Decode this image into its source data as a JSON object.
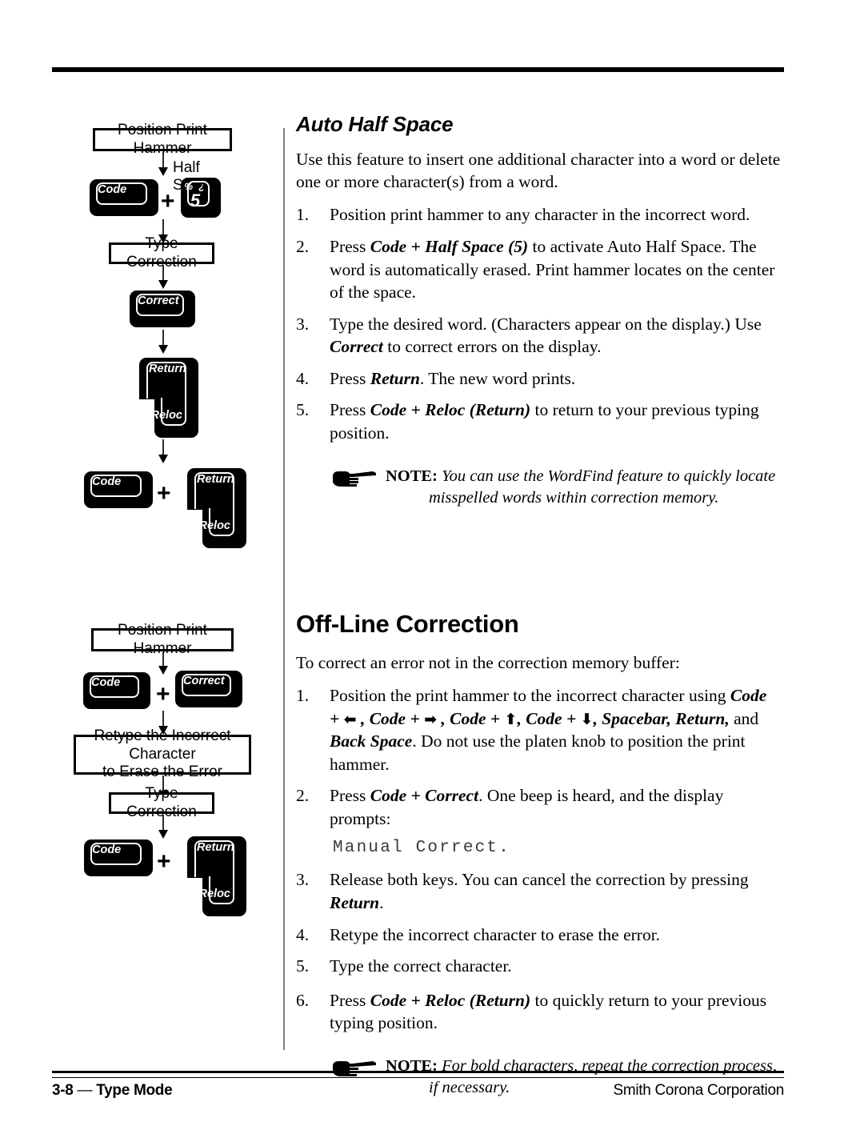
{
  "footer": {
    "left_page": "3-8",
    "left_dash": " — ",
    "left_section": "Type Mode",
    "right": "Smith Corona Corporation"
  },
  "sections": [
    {
      "id": "auto-half-space",
      "title": "Auto Half Space",
      "lead": "Use this feature to insert one additional character into a word or delete one or more character(s) from a word.",
      "steps": [
        {
          "num": "1.",
          "text": "Position print hammer to any character in the incorrect word."
        },
        {
          "num": "2.",
          "text": "Press Code + Half Space (5) to activate Auto Half Space. The word is automatically erased. Print hammer locates on the center of the space."
        },
        {
          "num": "3.",
          "text": "Type the desired word. (Characters appear on the display.) Use Correct to correct errors on the display."
        },
        {
          "num": "4.",
          "text": "Press Return. The new word prints."
        },
        {
          "num": "5.",
          "text": "Press Code + Reloc (Return) to return to your previous typing position."
        }
      ],
      "note": {
        "icon": "pointing-hand-icon",
        "label": "NOTE:",
        "line1": "You can use the WordFind feature to quickly locate",
        "line2": "misspelled words within correction memory."
      }
    },
    {
      "id": "off-line-correction",
      "title": "Off-Line Correction",
      "lead": "To correct an error not in the correction memory buffer:",
      "steps": [
        {
          "num": "1.",
          "text": "Position the print hammer to the incorrect character using Code + ←, Code + →, Code + ↑, Code + ↓, Spacebar, Return, and Back Space. Do not use the platen knob to position the print hammer."
        },
        {
          "num": "2.",
          "text": "Press Code + Correct. One beep is heard, and the display prompts:",
          "display_prompt": "Manual Correct."
        },
        {
          "num": "3.",
          "text": "Release both keys. You can cancel the correction by pressing Return."
        },
        {
          "num": "4.",
          "text": "Retype the incorrect character to erase the error."
        },
        {
          "num": "5.",
          "text": "Type the correct character."
        },
        {
          "num": "6.",
          "text": "Press Code + Reloc (Return) to quickly return to your previous typing position."
        }
      ],
      "note": {
        "icon": "pointing-hand-icon",
        "label": "NOTE:",
        "line1": "For bold characters, repeat the correction process,",
        "line2": "if necessary."
      }
    }
  ],
  "diagrams": {
    "flow1": {
      "box_position_print_hammer": "Position Print Hammer",
      "label_half_space": "Half Space",
      "key_code": "Code",
      "key_5_top": "% ¿",
      "key_5_main": "5",
      "plus": "+",
      "box_type_correction": "Type Correction",
      "key_correct": "Correct",
      "key_return_top": "Return",
      "key_return_bottom": "Reloc",
      "key_code2": "Code",
      "key_return2_top": "Return",
      "key_return2_bottom": "Reloc",
      "plus2": "+"
    },
    "flow2": {
      "box_position_print_hammer": "Position Print Hammer",
      "key_code": "Code",
      "key_correct": "Correct",
      "plus": "+",
      "box_retype": "Retype the Incorrect Character to Erase the Error",
      "box_retype_l1": "Retype the Incorrect Character",
      "box_retype_l2": "to Erase the Error",
      "box_type_correction": "Type Correction",
      "key_code2": "Code",
      "key_return_top": "Return",
      "key_return_bottom": "Reloc",
      "plus2": "+"
    }
  },
  "colors": {
    "rule": "#000000",
    "divider": "#808080",
    "key_body": "#000000",
    "key_outline": "#ffffff",
    "prompt_text": "#3a3a3a"
  }
}
